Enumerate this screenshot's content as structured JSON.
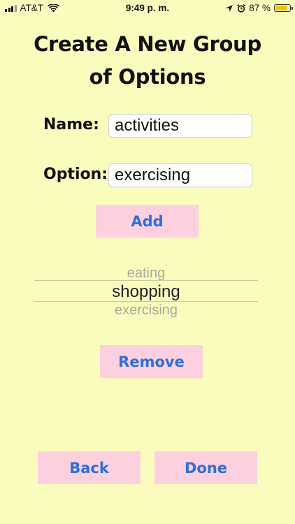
{
  "status_bar": {
    "carrier": "AT&T",
    "time": "9:49 p. m.",
    "battery": "87 %",
    "battery_level": 0.87,
    "icons": [
      "signal-icon",
      "wifi-icon",
      "location-icon",
      "alarm-icon",
      "battery-icon"
    ]
  },
  "title": {
    "line1": "Create A New Group",
    "line2": "of Options"
  },
  "form": {
    "name_label": "Name:",
    "name_value": "activities",
    "option_label": "Option:",
    "option_value": "exercising"
  },
  "buttons": {
    "add": "Add",
    "remove": "Remove",
    "back": "Back",
    "done": "Done"
  },
  "picker": {
    "items": [
      "eating",
      "shopping",
      "exercising"
    ],
    "selected": "shopping"
  },
  "colors": {
    "background": "#f9fcbc",
    "button_bg": "#fcd0df",
    "button_text": "#2f6fd8",
    "battery": "#f4c20d"
  }
}
